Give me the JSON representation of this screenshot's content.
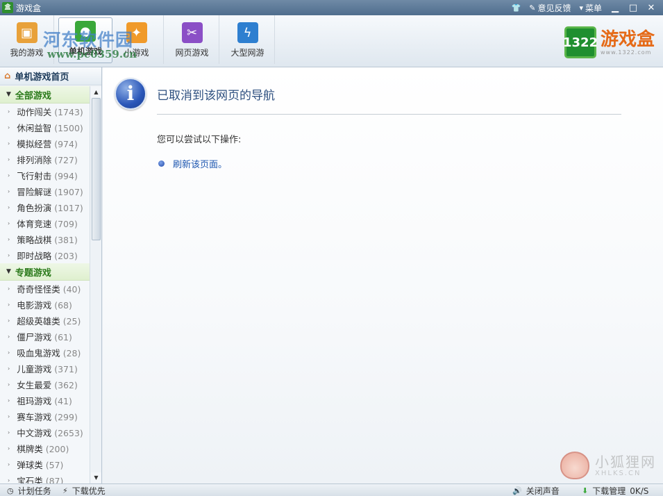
{
  "window": {
    "title": "游戏盒",
    "feedback": "意见反馈",
    "menu": "菜单"
  },
  "toolbar": {
    "tabs": [
      {
        "label": "我的游戏",
        "icon": "controller-icon",
        "color": "#e8a13a"
      },
      {
        "label": "单机游戏",
        "icon": "pc-game-icon",
        "color": "#3aa83a"
      },
      {
        "label": "小游戏",
        "icon": "flash-game-icon",
        "color": "#f09a2a"
      },
      {
        "label": "网页游戏",
        "icon": "web-game-icon",
        "color": "#8b4fc6"
      },
      {
        "label": "大型网游",
        "icon": "online-game-icon",
        "color": "#2e7fd0"
      }
    ],
    "watermark_title": "河东软件园",
    "watermark_url": "www.pc0359.cn",
    "logo_mark": "1322",
    "logo_name": "游戏盒",
    "logo_url": "www.1322.com"
  },
  "sidebar": {
    "home": "单机游戏首页",
    "groups": [
      {
        "title": "全部游戏",
        "items": [
          {
            "name": "动作闯关",
            "count": "(1743)"
          },
          {
            "name": "休闲益智",
            "count": "(1500)"
          },
          {
            "name": "模拟经营",
            "count": "(974)"
          },
          {
            "name": "排列消除",
            "count": "(727)"
          },
          {
            "name": "飞行射击",
            "count": "(994)"
          },
          {
            "name": "冒险解谜",
            "count": "(1907)"
          },
          {
            "name": "角色扮演",
            "count": "(1017)"
          },
          {
            "name": "体育竞速",
            "count": "(709)"
          },
          {
            "name": "策略战棋",
            "count": "(381)"
          },
          {
            "name": "即时战略",
            "count": "(203)"
          }
        ]
      },
      {
        "title": "专题游戏",
        "items": [
          {
            "name": "奇奇怪怪类",
            "count": "(40)"
          },
          {
            "name": "电影游戏",
            "count": "(68)"
          },
          {
            "name": "超级英雄类",
            "count": "(25)"
          },
          {
            "name": "僵尸游戏",
            "count": "(61)"
          },
          {
            "name": "吸血鬼游戏",
            "count": "(28)"
          },
          {
            "name": "儿童游戏",
            "count": "(371)"
          },
          {
            "name": "女生最爱",
            "count": "(362)"
          },
          {
            "name": "祖玛游戏",
            "count": "(41)"
          },
          {
            "name": "赛车游戏",
            "count": "(299)"
          },
          {
            "name": "中文游戏",
            "count": "(2653)"
          },
          {
            "name": "棋牌类",
            "count": "(200)"
          },
          {
            "name": "弹球类",
            "count": "(57)"
          },
          {
            "name": "宝石类",
            "count": "(87)"
          }
        ]
      }
    ]
  },
  "main": {
    "title": "已取消到该网页的导航",
    "subtitle": "您可以尝试以下操作:",
    "action": "刷新该页面。",
    "watermark_cn": "小狐狸网",
    "watermark_en": "XHLKS.CN"
  },
  "statusbar": {
    "scheduled": "计划任务",
    "priority": "下载优先",
    "sound": "关闭声音",
    "download_mgr": "下载管理",
    "speed": "0K/S"
  }
}
